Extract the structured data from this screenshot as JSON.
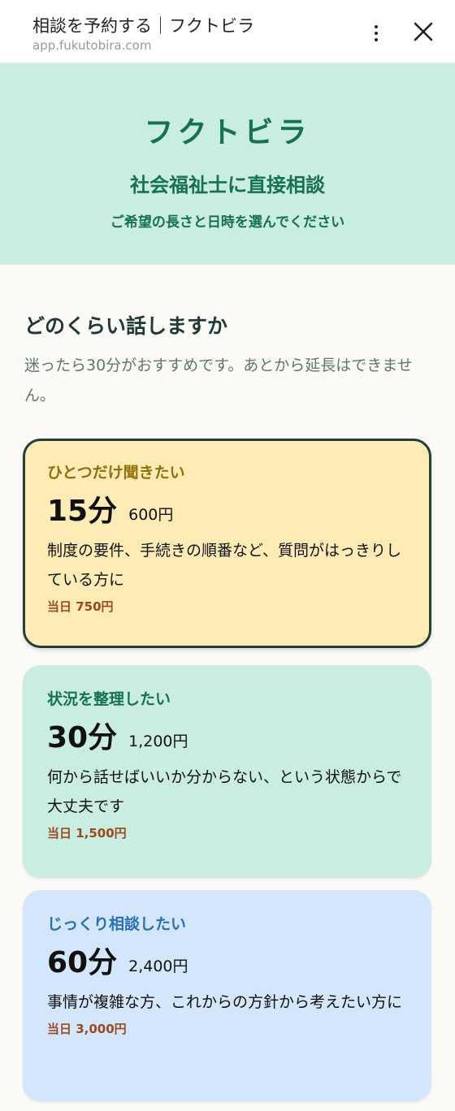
{
  "topbar": {
    "title": "相談を予約する｜フクトビラ",
    "url": "app.fukutobira.com"
  },
  "hero": {
    "brand": "フクトビラ",
    "subtitle": "社会福祉士に直接相談",
    "note": "ご希望の長さと日時を選んでください"
  },
  "section": {
    "title": "どのくらい話しますか",
    "description": "迷ったら30分がおすすめです。あとから延長はできません。"
  },
  "plans": [
    {
      "tag": "ひとつだけ聞きたい",
      "duration": "15分",
      "price": "600円",
      "description": "制度の要件、手続きの順番など、質問がはっきりしている方に",
      "same_day": "当日 750円",
      "selected": true
    },
    {
      "tag": "状況を整理したい",
      "duration": "30分",
      "price": "1,200円",
      "description": "何から話せばいいか分からない、という状態からで大丈夫です",
      "same_day": "当日 1,500円",
      "selected": false
    },
    {
      "tag": "じっくり相談したい",
      "duration": "60分",
      "price": "2,400円",
      "description": "事情が複雑な方、これからの方針から考えたい方に",
      "same_day": "当日 3,000円",
      "selected": false
    }
  ],
  "icons": {
    "menu": "more-vertical-icon",
    "close": "close-icon"
  },
  "colors": {
    "brand_green": "#167155",
    "hero_bg": "#c9ede0",
    "plan15_bg": "#feebb5",
    "plan30_bg": "#c9ede0",
    "plan60_bg": "#d3e6fb",
    "selected_border": "#223f3a",
    "same_day_price": "#9b4a1e"
  }
}
